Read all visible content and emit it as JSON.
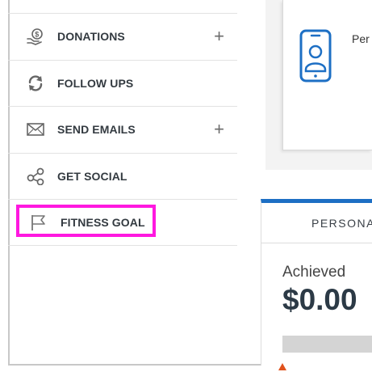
{
  "sidebar": {
    "items": [
      {
        "label": "DONATIONS",
        "icon": "donation-hand-icon",
        "has_add": true,
        "add_label": "+"
      },
      {
        "label": "FOLLOW UPS",
        "icon": "refresh-icon",
        "has_add": false
      },
      {
        "label": "SEND EMAILS",
        "icon": "envelope-icon",
        "has_add": true,
        "add_label": "+"
      },
      {
        "label": "GET SOCIAL",
        "icon": "share-icon",
        "has_add": false
      },
      {
        "label": "FITNESS GOAL",
        "icon": "flag-icon",
        "has_add": false,
        "highlighted": true
      }
    ]
  },
  "top_card": {
    "icon": "mobile-profile-icon",
    "text": "Per"
  },
  "panel": {
    "tab_label": "PERSONA",
    "achieved_label": "Achieved",
    "achieved_value": "$0.00",
    "progress_fraction": 0.0
  },
  "colors": {
    "highlight": "#ff18e0",
    "accent": "#1d6fc4",
    "marker": "#e0521d"
  }
}
